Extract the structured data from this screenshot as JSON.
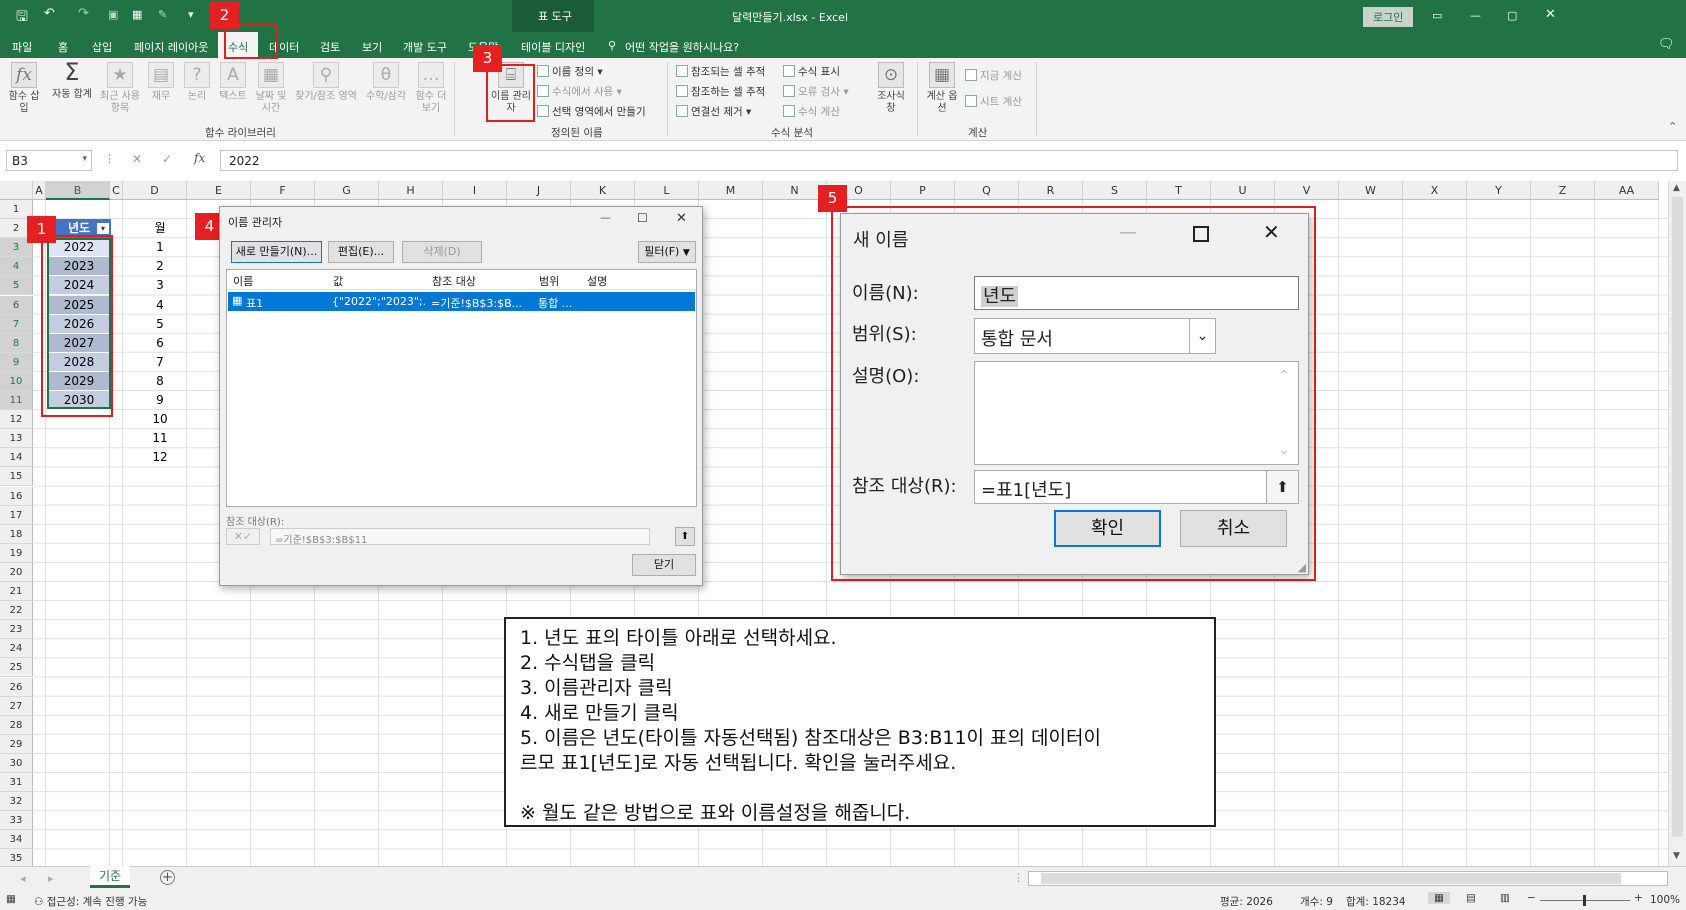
{
  "title_bar": {
    "file_title": "달력만들기.xlsx - Excel",
    "contextual_label": "표 도구",
    "login_label": "로그인"
  },
  "tabs": [
    "파일",
    "홈",
    "삽입",
    "페이지 레이아웃",
    "수식",
    "데이터",
    "검토",
    "보기",
    "개발 도구",
    "도움말",
    "테이블 디자인"
  ],
  "active_tab": "수식",
  "tell_me": "어떤 작업을 원하시나요?",
  "ribbon": {
    "function_library": {
      "label": "함수 라이브러리",
      "buttons": [
        "함수 삽입",
        "자동 합계",
        "최근 사용 항목",
        "재무",
        "논리",
        "텍스트",
        "날짜 및 시간",
        "찾기/참조 영역",
        "수학/삼각",
        "함수 더 보기"
      ]
    },
    "defined_names": {
      "label": "정의된 이름",
      "name_manager": "이름 관리자",
      "define_name": "이름 정의",
      "use_in_formula": "수식에서 사용",
      "create_from_selection": "선택 영역에서 만들기"
    },
    "formula_auditing": {
      "label": "수식 분석",
      "trace_precedents": "참조되는 셀 추적",
      "trace_dependents": "참조하는 셀 추적",
      "remove_arrows": "연결선 제거",
      "show_formulas": "수식 표시",
      "error_checking": "오류 검사",
      "evaluate_formula": "수식 계산",
      "watch_window": "조사식 창"
    },
    "calculation": {
      "label": "계산",
      "calc_options": "계산 옵션",
      "calc_now": "지금 계산",
      "calc_sheet": "시트 계산"
    }
  },
  "formula_bar": {
    "name_box": "B3",
    "fx": "fx",
    "value": "2022"
  },
  "columns": [
    "A",
    "B",
    "C",
    "D",
    "E",
    "F",
    "G",
    "H",
    "I",
    "J",
    "K",
    "L",
    "M",
    "N",
    "O",
    "P",
    "Q",
    "R",
    "S",
    "T",
    "U",
    "V",
    "W",
    "X",
    "Y",
    "Z",
    "AA"
  ],
  "rows": [
    "1",
    "2",
    "3",
    "4",
    "5",
    "6",
    "7",
    "8",
    "9",
    "10",
    "11",
    "12",
    "13",
    "14",
    "15",
    "16",
    "17",
    "18",
    "19",
    "20",
    "21",
    "22",
    "23",
    "24",
    "25",
    "26",
    "27",
    "28",
    "29",
    "30",
    "31",
    "32",
    "33",
    "34",
    "35"
  ],
  "year_table": {
    "header": "년도",
    "values": [
      "2022",
      "2023",
      "2024",
      "2025",
      "2026",
      "2027",
      "2028",
      "2029",
      "2030"
    ]
  },
  "month_table": {
    "header": "월",
    "values": [
      "1",
      "2",
      "3",
      "4",
      "5",
      "6",
      "7",
      "8",
      "9",
      "10",
      "11",
      "12"
    ]
  },
  "name_manager_dialog": {
    "title": "이름 관리자",
    "buttons": {
      "new": "새로 만들기(N)...",
      "edit": "편집(E)...",
      "delete": "삭제(D)",
      "filter": "필터(F)",
      "close": "닫기"
    },
    "columns": [
      "이름",
      "값",
      "참조 대상",
      "범위",
      "설명"
    ],
    "rows": [
      {
        "name": "표1",
        "value": "{\"2022\";\"2023\";...",
        "refers": "=기준!$B$3:$B...",
        "scope": "통합 ...",
        "desc": ""
      }
    ],
    "refers_label": "참조 대상(R):",
    "refers_value": "=기준!$B$3:$B$11"
  },
  "new_name_dialog": {
    "title": "새 이름",
    "name_label": "이름(N):",
    "name_value": "년도",
    "scope_label": "범위(S):",
    "scope_value": "통합 문서",
    "comment_label": "설명(O):",
    "refers_label": "참조 대상(R):",
    "refers_value": "=표1[년도]",
    "ok": "확인",
    "cancel": "취소"
  },
  "instructions": [
    "1. 년도 표의 타이틀 아래로 선택하세요.",
    "2. 수식탭을 클릭",
    "3. 이름관리자 클릭",
    "4. 새로 만들기 클릭",
    "5. 이름은 년도(타이틀 자동선택됨) 참조대상은 B3:B11이 표의 데이터이",
    "르모 표1[년도]로 자동 선택됩니다. 확인을 눌러주세요.",
    "",
    "※ 월도 같은 방법으로 표와 이름설정을 해줍니다."
  ],
  "badges": [
    "1",
    "2",
    "3",
    "4",
    "5"
  ],
  "sheet_tab": "기준",
  "status": {
    "accessibility": "접근성: 계속 진행 가능",
    "average": "평균: 2026",
    "count": "개수: 9",
    "sum": "합계: 18234",
    "zoom": "100%"
  },
  "colors": {
    "excel_green": "#217346",
    "table_header": "#4472c4",
    "selection_blue": "#0078d7",
    "red_annotation": "#e52020"
  }
}
